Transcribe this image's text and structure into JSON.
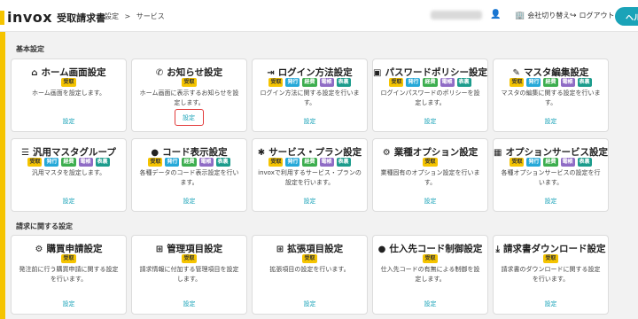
{
  "header": {
    "brand": "invox",
    "product": "受取請求書",
    "breadcrumb": [
      "設定",
      ">",
      "サービス"
    ],
    "switch_company": "会社切り替え",
    "logout": "ログアウト",
    "help": "ヘル"
  },
  "tag_labels": {
    "receive": "受取",
    "issue": "発行",
    "expense": "経費",
    "esign": "電帳",
    "rep": "表裏"
  },
  "sections": [
    {
      "title": "基本設定",
      "cards": [
        {
          "title": "ホーム画面設定",
          "icon": "home-icon",
          "tags": [
            "受取"
          ],
          "desc": "ホーム画面を設定します。",
          "link": "設定"
        },
        {
          "title": "お知らせ設定",
          "icon": "megaphone-icon",
          "tags": [
            "受取"
          ],
          "desc": "ホーム画面に表示するお知らせを設定します。",
          "link": "設定"
        },
        {
          "title": "ログイン方法設定",
          "icon": "login-icon",
          "tags": [
            "受取",
            "発行",
            "経費",
            "電帳",
            "表裏"
          ],
          "desc": "ログイン方法に関する設定を行います。",
          "link": "設定"
        },
        {
          "title": "パスワードポリシー設定",
          "icon": "lock-icon",
          "tags": [
            "受取",
            "発行",
            "経費",
            "電帳",
            "表裏"
          ],
          "desc": "ログインパスワードのポリシーを設定します。",
          "link": "設定"
        },
        {
          "title": "マスタ編集設定",
          "icon": "edit-icon",
          "tags": [
            "受取",
            "発行",
            "経費",
            "電帳",
            "表裏"
          ],
          "desc": "マスタの編集に関する設定を行います。",
          "link": "設定"
        },
        {
          "title": "汎用マスタグループ",
          "icon": "list-icon",
          "tags": [
            "受取",
            "発行",
            "経費",
            "電帳",
            "表裏"
          ],
          "desc": "汎用マスタを設定します。",
          "link": "設定"
        },
        {
          "title": "コード表示設定",
          "icon": "dots-icon",
          "tags": [
            "受取",
            "発行",
            "経費",
            "電帳",
            "表裏"
          ],
          "desc": "各種データのコード表示設定を行います。",
          "link": "設定"
        },
        {
          "title": "サービス・プラン設定",
          "icon": "star-gear-icon",
          "tags": [
            "受取",
            "発行",
            "経費",
            "電帳",
            "表裏"
          ],
          "desc": "invoxで利用するサービス・プランの設定を行います。",
          "link": "設定"
        },
        {
          "title": "業種オプション設定",
          "icon": "gears-icon",
          "tags": [
            "受取"
          ],
          "desc": "業種固有のオプション設定を行います。",
          "link": "設定"
        },
        {
          "title": "オプションサービス設定",
          "icon": "grid-icon",
          "tags": [
            "受取",
            "発行",
            "経費",
            "電帳",
            "表裏"
          ],
          "desc": "各種オプションサービスの設定を行います。",
          "link": "設定"
        }
      ]
    },
    {
      "title": "請求に関する設定",
      "cards": [
        {
          "title": "購買申請設定",
          "icon": "gears-icon",
          "tags": [
            "受取"
          ],
          "desc": "発注前に行う購買申請に関する設定を行います。",
          "link": "設定"
        },
        {
          "title": "管理項目設定",
          "icon": "sitemap-icon",
          "tags": [
            "受取"
          ],
          "desc": "請求情報に付加する管理項目を設定します。",
          "link": "設定"
        },
        {
          "title": "拡張項目設定",
          "icon": "sitemap-icon",
          "tags": [
            "受取"
          ],
          "desc": "拡張項目の設定を行います。",
          "link": "設定"
        },
        {
          "title": "仕入先コード制御設定",
          "icon": "dots-icon",
          "tags": [
            "受取"
          ],
          "desc": "仕入先コードの有無による制御を設定します。",
          "link": "設定"
        },
        {
          "title": "請求書ダウンロード設定",
          "icon": "download-icon",
          "tags": [
            "受取"
          ],
          "desc": "請求書のダウンロードに関する設定を行います。",
          "link": "設定"
        }
      ]
    }
  ]
}
